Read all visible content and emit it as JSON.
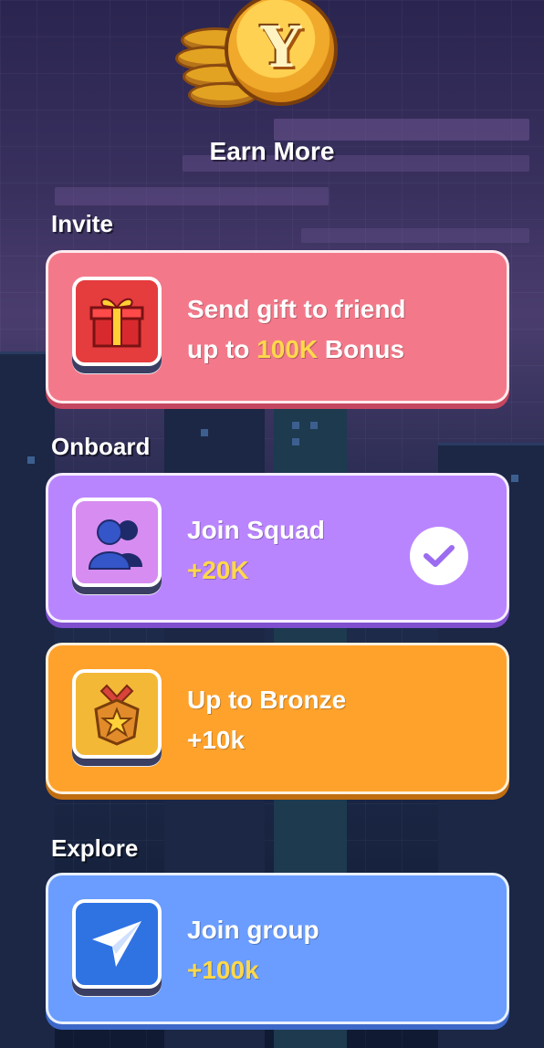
{
  "header": {
    "title": "Earn More",
    "coin_letter": "Y"
  },
  "sections": {
    "invite": "Invite",
    "onboard": "Onboard",
    "explore": "Explore"
  },
  "cards": {
    "invite": {
      "line1": "Send gift to friend",
      "line2_prefix": "up to",
      "line2_highlight": "100K",
      "line2_suffix": "Bonus",
      "icon": "gift-icon"
    },
    "squad": {
      "title": "Join Squad",
      "reward": "+20K",
      "icon": "group-icon",
      "status": "completed"
    },
    "bronze": {
      "title": "Up to Bronze",
      "reward": "+10k",
      "icon": "medal-icon"
    },
    "group": {
      "title": "Join group",
      "reward": "+100k",
      "icon": "paper-plane-icon"
    }
  },
  "colors": {
    "invite": "#f3798a",
    "squad": "#b985ff",
    "bronze": "#ffa22b",
    "group": "#6a9dff",
    "highlight": "#ffd84a"
  }
}
